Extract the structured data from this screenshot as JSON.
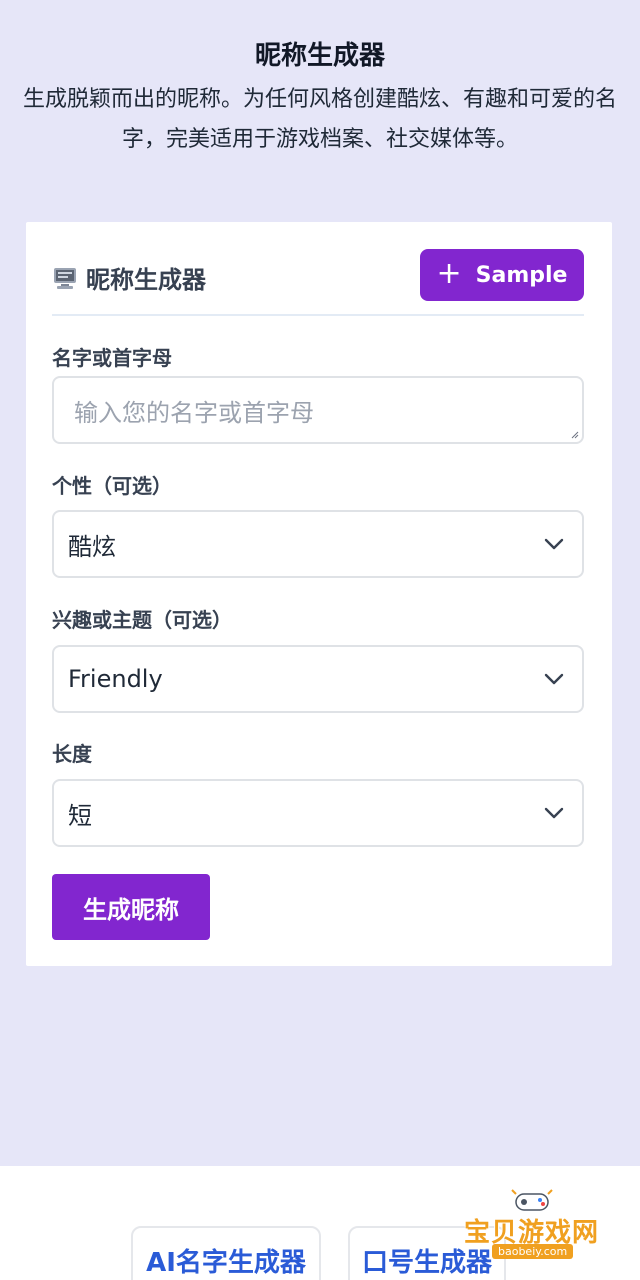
{
  "hero": {
    "title": "昵称生成器",
    "description": "生成脱颖而出的昵称。为任何风格创建酷炫、有趣和可爱的名字，完美适用于游戏档案、社交媒体等。"
  },
  "card": {
    "icon": "computer-icon",
    "title": "昵称生成器",
    "sample_button": {
      "icon": "plus-icon",
      "label": "Sample"
    },
    "fields": {
      "name": {
        "label": "名字或首字母",
        "placeholder": "输入您的名字或首字母",
        "value": ""
      },
      "personality": {
        "label": "个性（可选）",
        "value": "酷炫"
      },
      "interest": {
        "label": "兴趣或主题（可选）",
        "value": "Friendly"
      },
      "length": {
        "label": "长度",
        "value": "短"
      }
    },
    "generate_button": "生成昵称"
  },
  "footer": {
    "links": [
      "AI名字生成器",
      "口号生成器"
    ]
  },
  "watermark": {
    "text": "宝贝游戏网",
    "url": "baobeiy.com"
  },
  "colors": {
    "accent": "#8226cf",
    "page_background": "#e6e6f8",
    "link": "#2a5bd7",
    "watermark": "#f0a020"
  }
}
